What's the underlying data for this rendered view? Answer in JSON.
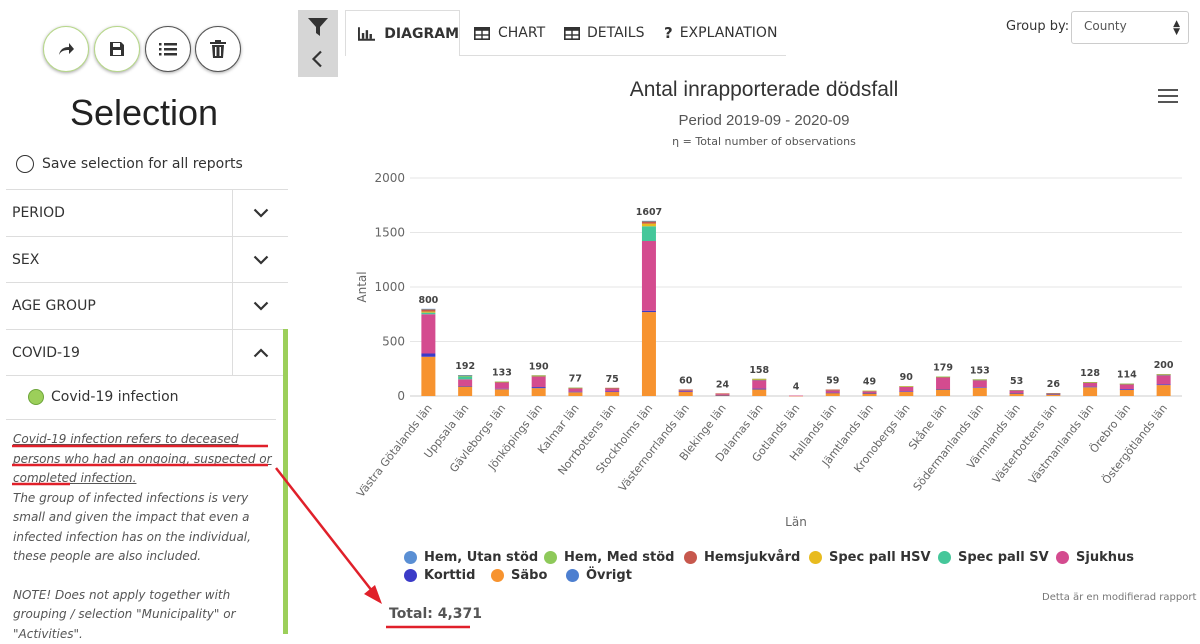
{
  "sidebar": {
    "title": "Selection",
    "save_all_label": "Save selection for all reports",
    "accordion": [
      {
        "label": "PERIOD",
        "open": false
      },
      {
        "label": "SEX",
        "open": false
      },
      {
        "label": "AGE GROUP",
        "open": false
      },
      {
        "label": "COVID-19",
        "open": true
      }
    ],
    "covid_option": "Covid-19 infection",
    "desc_underlined": "Covid-19 infection refers to deceased persons who had an ongoing, suspected or completed infection.",
    "desc_body": "The group of infected infections is very small and given the impact that even a infected infection has on the individual, these people are also included.",
    "desc_note": "NOTE! Does not apply together with grouping / selection \"Municipality\" or \"Activities\"."
  },
  "toolbar": {
    "icons": [
      "share-icon",
      "save-icon",
      "list-icon",
      "delete-icon"
    ]
  },
  "tabs": [
    {
      "label": "DIAGRAM",
      "icon": "bar-chart-icon",
      "active": true
    },
    {
      "label": "CHART",
      "icon": "table-icon",
      "active": false
    },
    {
      "label": "DETAILS",
      "icon": "table-icon",
      "active": false
    },
    {
      "label": "EXPLANATION",
      "icon": "question-icon",
      "active": false
    }
  ],
  "group_by": {
    "label": "Group by:",
    "value": "County"
  },
  "chart_header": {
    "title": "Antal inrapporterade dödsfall",
    "subtitle": "Period 2019-09 - 2020-09",
    "note": "η = Total number of observations"
  },
  "chart_data": {
    "type": "bar",
    "stacked": true,
    "ylabel": "Antal",
    "xlabel": "Län",
    "ylim": [
      0,
      2000
    ],
    "yticks": [
      0,
      500,
      1000,
      1500,
      2000
    ],
    "categories": [
      "Västra Götalands län",
      "Uppsala län",
      "Gävleborgs län",
      "Jönköpings län",
      "Kalmar län",
      "Norrbottens län",
      "Stockholms län",
      "Västernorrlands län",
      "Blekinge län",
      "Dalarnas län",
      "Gotlands län",
      "Hallands län",
      "Jämtlands län",
      "Kronobergs län",
      "Skåne län",
      "Södermanlands län",
      "Värmlands län",
      "Västerbottens län",
      "Västmanlands län",
      "Örebro län",
      "Östergötlands län"
    ],
    "totals": [
      800,
      192,
      133,
      190,
      77,
      75,
      1607,
      60,
      24,
      158,
      4,
      59,
      49,
      90,
      179,
      153,
      53,
      26,
      128,
      114,
      200
    ],
    "series": [
      {
        "name": "Säbo",
        "color": "#f7932f",
        "values": [
          360,
          88,
          62,
          72,
          34,
          40,
          770,
          40,
          8,
          60,
          2,
          28,
          25,
          40,
          60,
          75,
          25,
          15,
          80,
          55,
          100
        ]
      },
      {
        "name": "Korttid",
        "color": "#3b3bc8",
        "values": [
          30,
          3,
          5,
          10,
          6,
          2,
          12,
          2,
          2,
          8,
          0,
          3,
          2,
          3,
          4,
          5,
          2,
          2,
          6,
          8,
          7
        ]
      },
      {
        "name": "Sjukhus",
        "color": "#d44b8f",
        "values": [
          360,
          62,
          60,
          100,
          33,
          30,
          640,
          15,
          12,
          80,
          2,
          25,
          20,
          45,
          110,
          66,
          24,
          7,
          38,
          45,
          85
        ]
      },
      {
        "name": "Spec pall SV",
        "color": "#45c79a",
        "values": [
          15,
          30,
          2,
          2,
          0,
          1,
          135,
          1,
          0,
          2,
          0,
          1,
          1,
          1,
          2,
          3,
          1,
          1,
          1,
          2,
          3
        ]
      },
      {
        "name": "Spec pall HSV",
        "color": "#e8bb1f",
        "values": [
          10,
          3,
          1,
          2,
          1,
          1,
          25,
          1,
          1,
          3,
          0,
          1,
          1,
          1,
          1,
          2,
          0,
          0,
          1,
          2,
          3
        ]
      },
      {
        "name": "Hemsjukvård",
        "color": "#c7584d",
        "values": [
          20,
          4,
          2,
          3,
          2,
          1,
          20,
          1,
          1,
          4,
          0,
          1,
          0,
          0,
          1,
          1,
          1,
          1,
          1,
          1,
          1
        ]
      },
      {
        "name": "Hem, Med stöd",
        "color": "#8ec95a",
        "values": [
          3,
          1,
          1,
          1,
          1,
          0,
          3,
          0,
          0,
          1,
          0,
          0,
          0,
          0,
          1,
          1,
          0,
          0,
          1,
          1,
          1
        ]
      },
      {
        "name": "Hem, Utan stöd",
        "color": "#5a8fd4",
        "values": [
          2,
          1,
          0,
          0,
          0,
          0,
          2,
          0,
          0,
          0,
          0,
          0,
          0,
          0,
          0,
          0,
          0,
          0,
          0,
          0,
          0
        ]
      },
      {
        "name": "Övrigt",
        "color": "#4d7fd0",
        "values": [
          0,
          0,
          0,
          0,
          0,
          0,
          0,
          0,
          0,
          0,
          0,
          0,
          0,
          0,
          0,
          0,
          0,
          0,
          0,
          0,
          0
        ]
      }
    ]
  },
  "legend": [
    {
      "label": "Hem, Utan stöd",
      "color": "#5a8fd4"
    },
    {
      "label": "Hem, Med stöd",
      "color": "#8ec95a"
    },
    {
      "label": "Hemsjukvård",
      "color": "#c7584d"
    },
    {
      "label": "Spec pall HSV",
      "color": "#e8bb1f"
    },
    {
      "label": "Spec pall SV",
      "color": "#45c79a"
    },
    {
      "label": "Sjukhus",
      "color": "#d44b8f"
    },
    {
      "label": "Korttid",
      "color": "#3b3bc8"
    },
    {
      "label": "Säbo",
      "color": "#f7932f"
    },
    {
      "label": "Övrigt",
      "color": "#4d7fd0"
    }
  ],
  "footnote": "Detta är en modifierad rapport",
  "total_label": "Total: 4,371",
  "annotation_color": "#e0202a"
}
